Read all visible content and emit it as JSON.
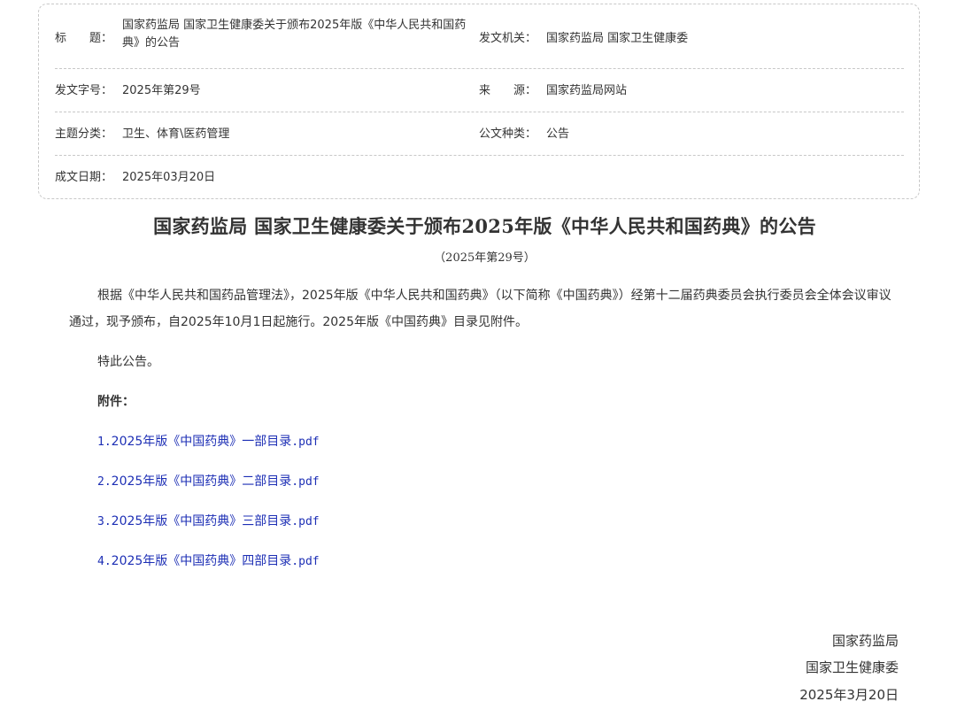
{
  "meta": {
    "title_label": "标　　题：",
    "title_value": "国家药监局 国家卫生健康委关于颁布2025年版《中华人民共和国药典》的公告",
    "issuer_label": "发文机关：",
    "issuer_value": "国家药监局 国家卫生健康委",
    "docno_label": "发文字号：",
    "docno_value": "2025年第29号",
    "source_label": "来　　源：",
    "source_value": "国家药监局网站",
    "topic_label": "主题分类：",
    "topic_value": "卫生、体育\\医药管理",
    "type_label": "公文种类：",
    "type_value": "公告",
    "date_label": "成文日期：",
    "date_value": "2025年03月20日"
  },
  "article": {
    "title": "国家药监局 国家卫生健康委关于颁布2025年版《中华人民共和国药典》的公告",
    "docno": "（2025年第29号）",
    "body": "根据《中华人民共和国药品管理法》，2025年版《中华人民共和国药典》（以下简称《中国药典》）经第十二届药典委员会执行委员会全体会议审议通过，现予颁布，自2025年10月1日起施行。2025年版《中国药典》目录见附件。",
    "closing": "特此公告。",
    "attachments_label": "附件：",
    "attachments": [
      {
        "num": "1.",
        "name": "2025年版《中国药典》一部目录",
        "ext": ".pdf"
      },
      {
        "num": "2.",
        "name": "2025年版《中国药典》二部目录",
        "ext": ".pdf"
      },
      {
        "num": "3.",
        "name": "2025年版《中国药典》三部目录",
        "ext": ".pdf"
      },
      {
        "num": "4.",
        "name": "2025年版《中国药典》四部目录",
        "ext": ".pdf"
      }
    ],
    "signatories": [
      "国家药监局",
      "国家卫生健康委"
    ],
    "sign_date": "2025年3月20日"
  },
  "colors": {
    "link": "#1d2fb5",
    "text": "#333333",
    "border": "#c8c8c8"
  }
}
